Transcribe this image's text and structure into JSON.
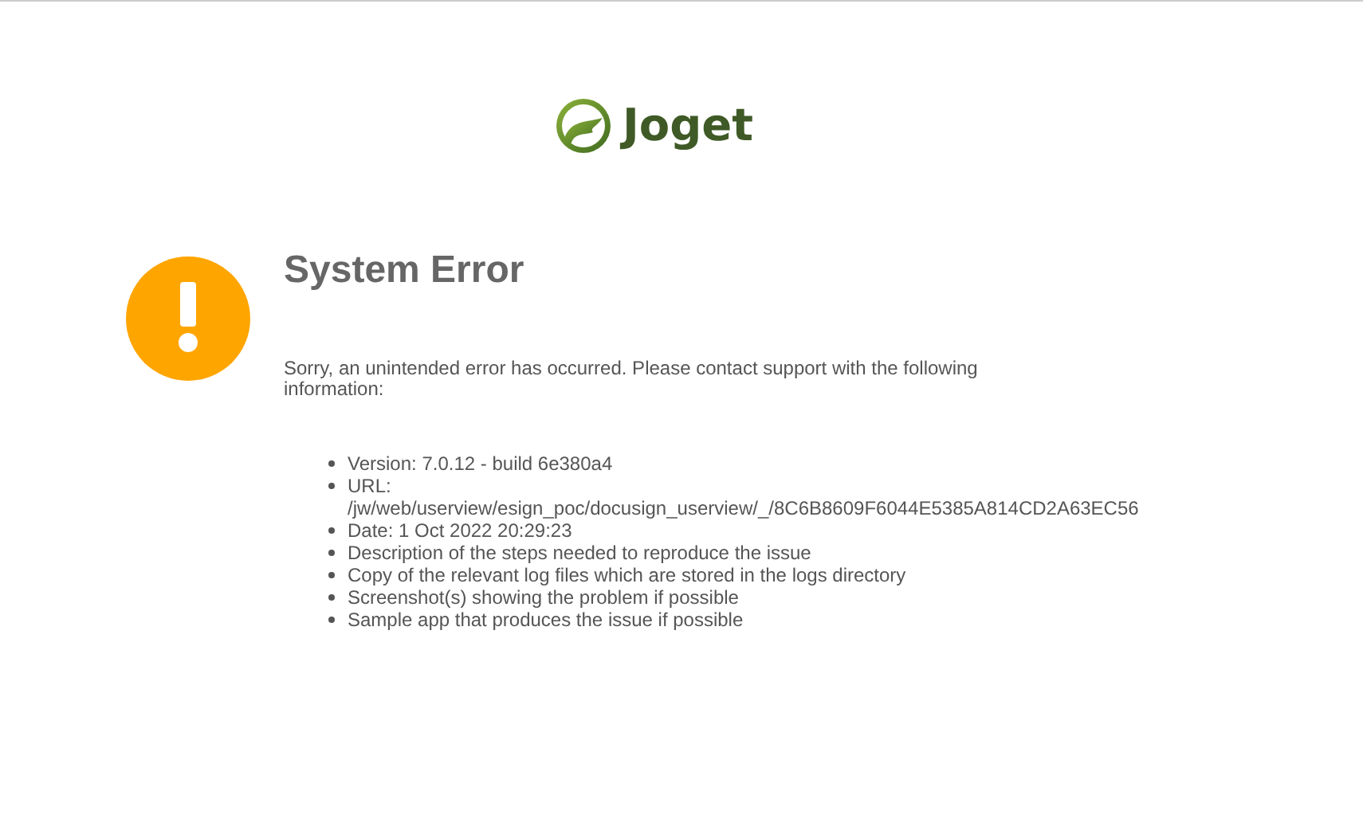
{
  "logo": {
    "name": "Joget"
  },
  "title": "System Error",
  "message": "Sorry, an unintended error has occurred. Please contact support with the following information:",
  "details": [
    {
      "kind": "text",
      "text": "Version: 7.0.12 - build 6e380a4"
    },
    {
      "kind": "url",
      "label": "URL:",
      "value": "/jw/web/userview/esign_poc/docusign_userview/_/8C6B8609F6044E5385A814CD2A63EC56"
    },
    {
      "kind": "text",
      "text": "Date: 1 Oct 2022 20:29:23"
    },
    {
      "kind": "text",
      "text": "Description of the steps needed to reproduce the issue"
    },
    {
      "kind": "text",
      "text": "Copy of the relevant log files which are stored in the logs directory"
    },
    {
      "kind": "text",
      "text": "Screenshot(s) showing the problem if possible"
    },
    {
      "kind": "text",
      "text": "Sample app that produces the issue if possible"
    }
  ]
}
